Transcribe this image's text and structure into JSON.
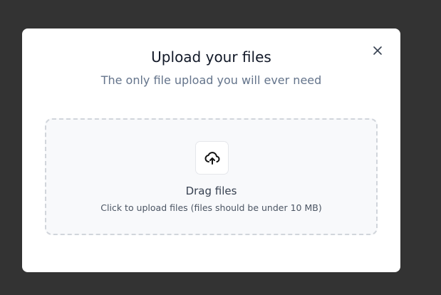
{
  "modal": {
    "title": "Upload your files",
    "subtitle": "The only file upload you will ever need",
    "close_icon": "close-icon"
  },
  "dropzone": {
    "icon": "cloud-upload-icon",
    "label": "Drag files",
    "hint": "Click to upload files (files should be under 10 MB)"
  }
}
